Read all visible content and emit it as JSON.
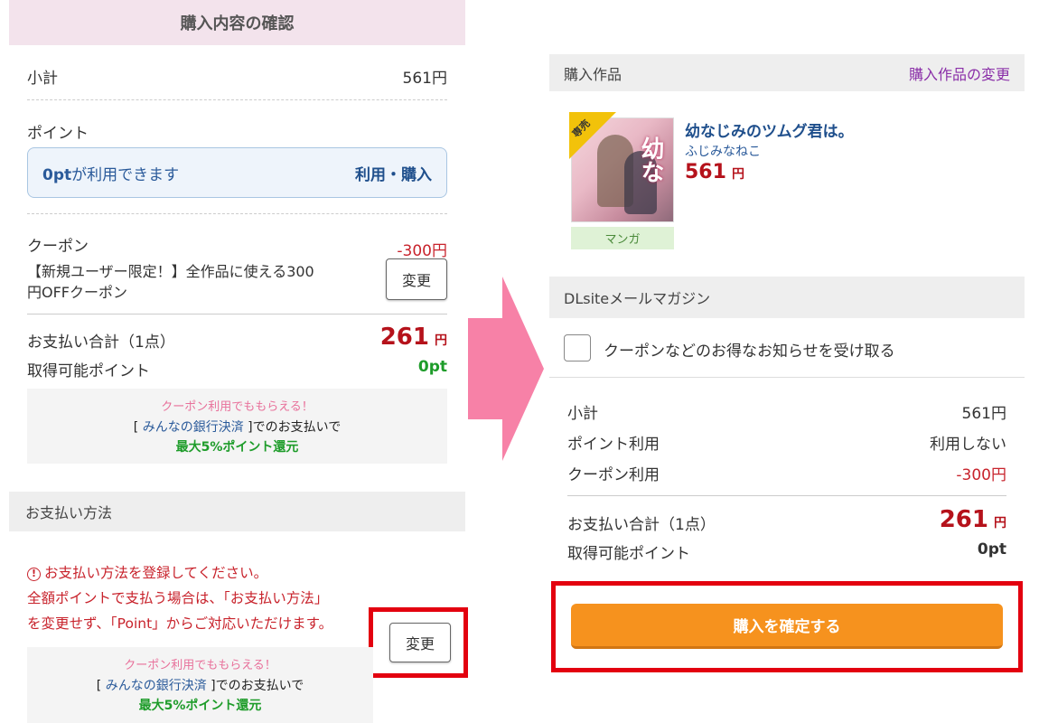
{
  "left": {
    "header_title": "購入内容の確認",
    "subtotal_label": "小計",
    "subtotal_value": "561円",
    "point_label": "ポイント",
    "point_available_strong": "0pt",
    "point_available_rest": "が利用できます",
    "point_action": "利用・購入",
    "coupon_label": "クーポン",
    "coupon_value": "-300円",
    "coupon_desc_line1": "【新規ユーザー限定！】全作品に使える300",
    "coupon_desc_line2": "円OFFクーポン",
    "coupon_change": "変更",
    "total_label": "お支払い合計（1点）",
    "total_amount": "261",
    "total_yen": "円",
    "earn_label": "取得可能ポイント",
    "earn_value": "0pt",
    "promo": {
      "line1": "クーポン利用でももらえる！",
      "bracket_open": "[ ",
      "bank": "みんなの銀行決済",
      "bracket_close": " ]でのお支払いで",
      "bonus": "最大5%ポイント還元"
    },
    "payment_section_title": "お支払い方法",
    "warn_icon": "!",
    "warn_line1": "お支払い方法を登録してください。",
    "warn_line2": "全額ポイントで支払う場合は、「お支払い方法」",
    "warn_line3": "を変更せず、「Point」からご対応いただけます。",
    "payment_change": "変更"
  },
  "right": {
    "works_section_title": "購入作品",
    "works_change_link": "購入作品の変更",
    "badge": "専売",
    "cover_title": "幼な",
    "product_title": "幼なじみのツムグ君は。",
    "product_author": "ふじみなねこ",
    "product_price": "561",
    "product_yen": "円",
    "genre": "マンガ",
    "mail_section_title": "DLsiteメールマガジン",
    "mail_checkbox_label": "クーポンなどのお得なお知らせを受け取る",
    "subtotal_label": "小計",
    "subtotal_value": "561円",
    "point_use_label": "ポイント利用",
    "point_use_value": "利用しない",
    "coupon_use_label": "クーポン利用",
    "coupon_use_value": "-300円",
    "total_label": "お支払い合計（1点）",
    "total_amount": "261",
    "total_yen": "円",
    "earn_label": "取得可能ポイント",
    "earn_value": "0pt",
    "confirm_button": "購入を確定する"
  },
  "colors": {
    "header_bg": "#f3e3ec",
    "price_red": "#b5121b",
    "point_green": "#1e9c2a",
    "link_purple": "#8a2fa8",
    "buy_orange": "#f6921e",
    "arrow_pink": "#f781a7",
    "highlight_red": "#e3000f"
  }
}
